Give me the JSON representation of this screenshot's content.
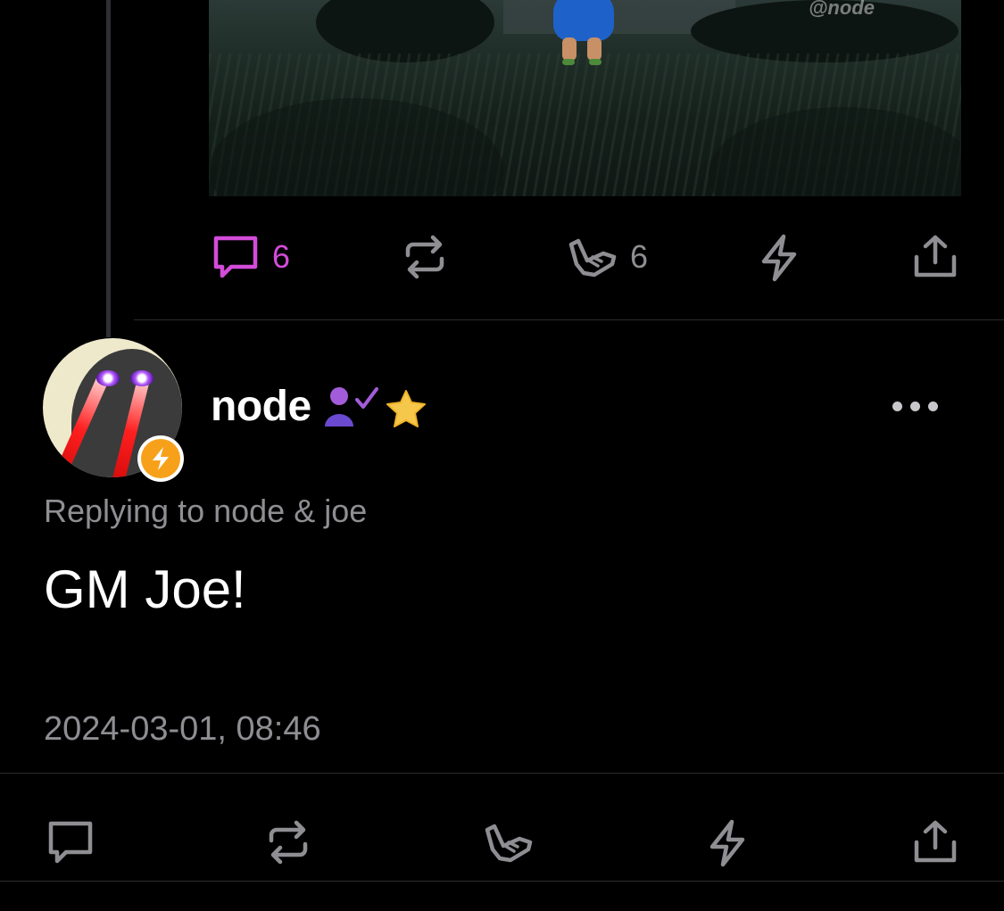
{
  "post": {
    "watermark": "@node",
    "actions": {
      "reply_count": "6",
      "reaction_count": "6"
    },
    "colors": {
      "active_reply": "#d34cd9",
      "icon": "#8e8e93"
    }
  },
  "reply": {
    "author": "node",
    "badges": [
      "verified-user-icon",
      "star-icon",
      "lightning-badge-icon"
    ],
    "replying_to": "Replying to node & joe",
    "content": "GM Joe!",
    "timestamp": "2024-03-01, 08:46"
  },
  "icons": {
    "reply": "comment-icon",
    "repost": "repost-icon",
    "reaction": "shaka-icon",
    "zap": "zap-icon",
    "share": "share-icon",
    "more": "more-icon"
  }
}
